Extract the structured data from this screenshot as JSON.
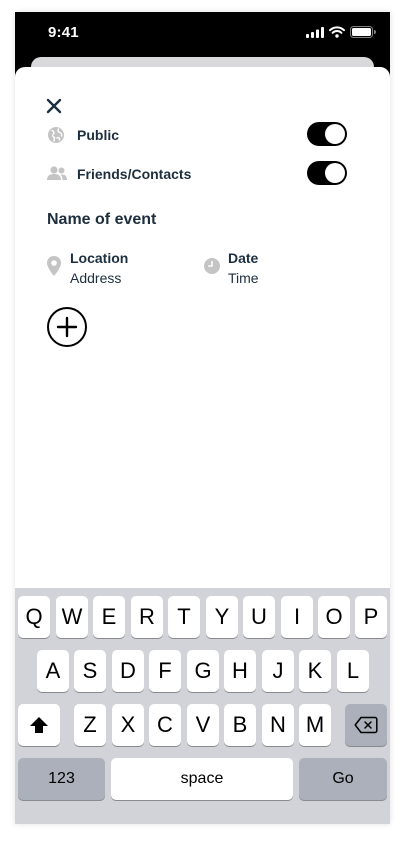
{
  "status_bar": {
    "time": "9:41"
  },
  "privacy": {
    "public_label": "Public",
    "friends_label": "Friends/Contacts"
  },
  "event": {
    "name_placeholder": "Name of event",
    "location_label": "Location",
    "location_value": "Address",
    "date_label": "Date",
    "date_value": "Time"
  },
  "keyboard": {
    "row1": [
      "Q",
      "W",
      "E",
      "R",
      "T",
      "Y",
      "U",
      "I",
      "O",
      "P"
    ],
    "row2": [
      "A",
      "S",
      "D",
      "F",
      "G",
      "H",
      "J",
      "K",
      "L"
    ],
    "row3": [
      "Z",
      "X",
      "C",
      "V",
      "B",
      "N",
      "M"
    ],
    "numbers_key": "123",
    "space_key": "space",
    "return_key": "Go"
  },
  "colors": {
    "text_dark": "#1d2f3f",
    "icon_gray": "#c4c4c4",
    "toggle_on": "#000000",
    "keyboard_bg": "#d2d3d9"
  },
  "icons": {
    "public": "globe-icon",
    "friends": "people-icon",
    "location": "map-pin-icon",
    "date": "clock-icon"
  }
}
